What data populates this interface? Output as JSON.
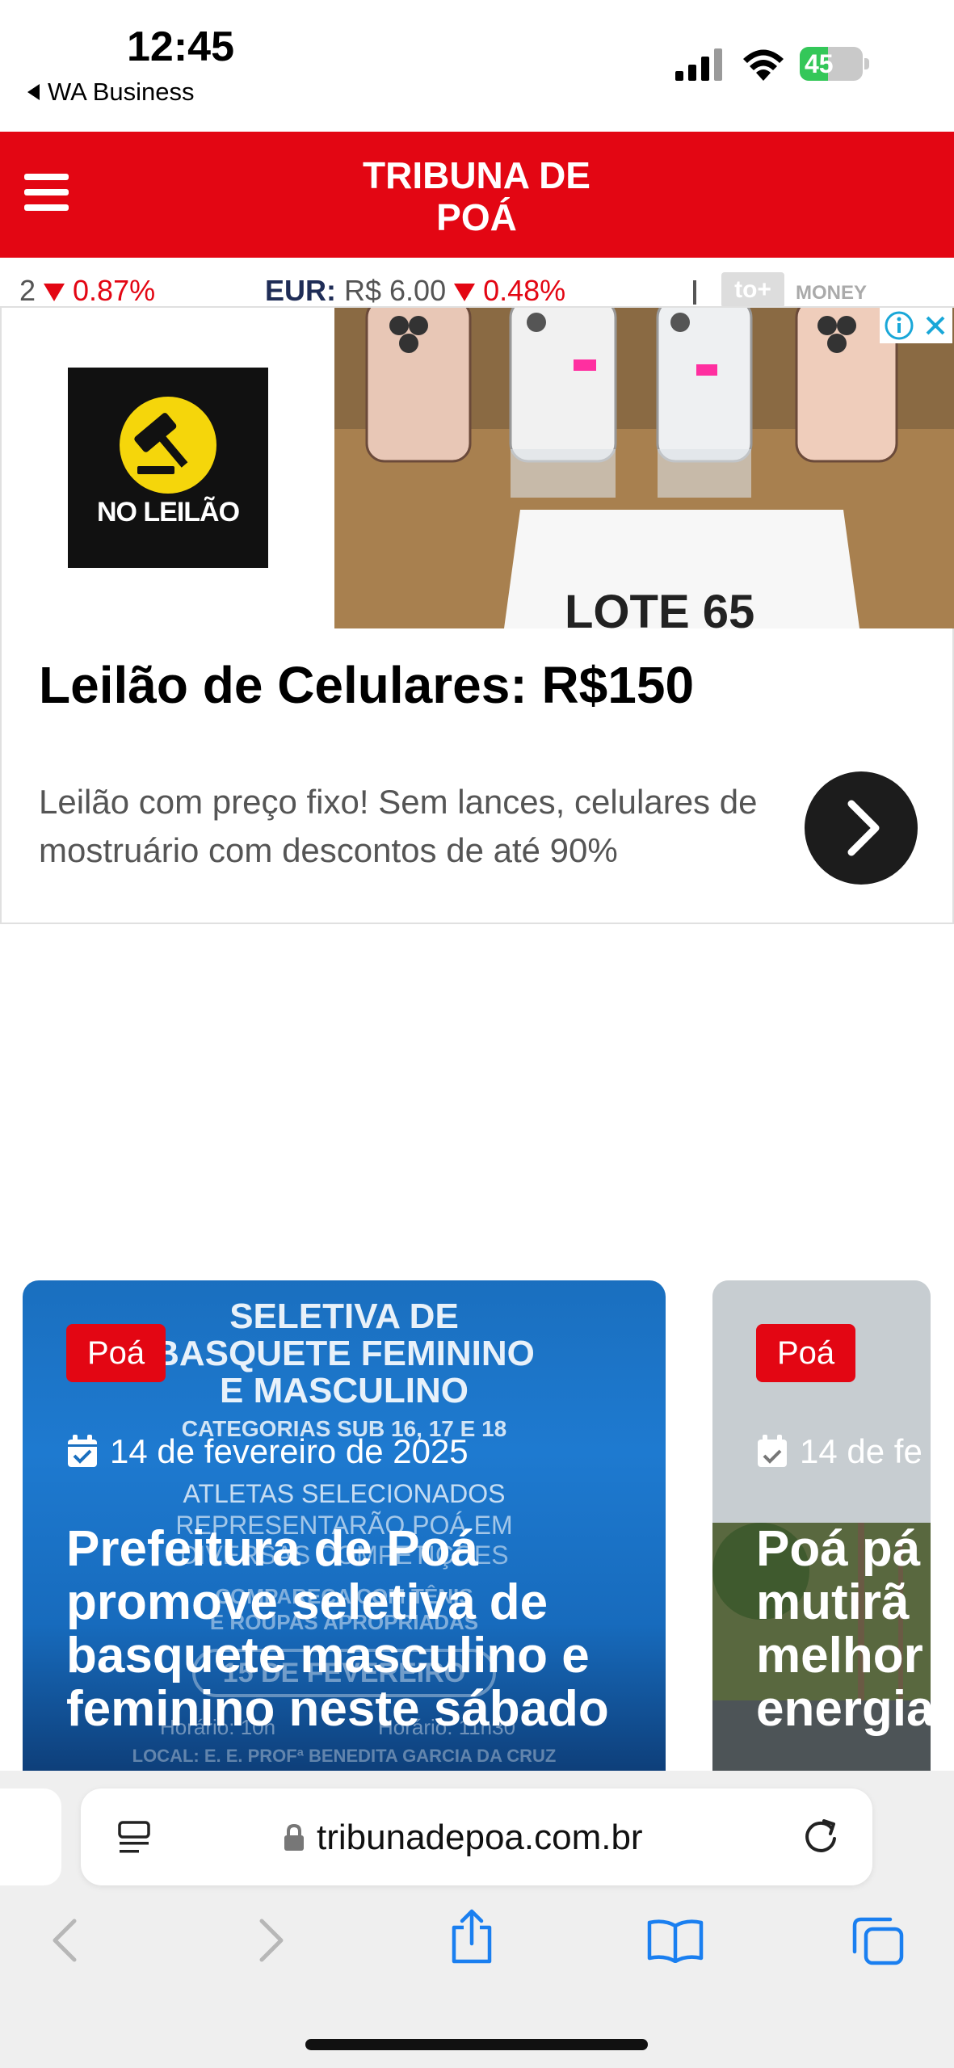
{
  "status_bar": {
    "time": "12:45",
    "back_app": "WA Business",
    "battery": {
      "level_text": "45",
      "level_fraction": 0.45
    }
  },
  "site": {
    "title_line1": "TRIBUNA DE",
    "title_line2": "POÁ"
  },
  "ticker": {
    "item1_value": "2",
    "item1_pct": "0.87%",
    "item2_label": "EUR:",
    "item2_value": "R$ 6.00",
    "item2_pct": "0.48%",
    "badge": "to+",
    "badge_label": "MONEY"
  },
  "ad": {
    "logo_text": "NO LEILÃO",
    "photo_label": "LOTE 65",
    "headline": "Leilão de Celulares: R$150",
    "description": "Leilão com preço fixo! Sem lances, celulares de mostruário com descontos de até 90%"
  },
  "cards": [
    {
      "category": "Poá",
      "date": "14 de fevereiro de 2025",
      "title": "Prefeitura de Poá promove seletiva de basquete masculino e feminino neste sábado",
      "poster": {
        "l1": "SELETIVA DE",
        "l2": "BASQUETE FEMININO",
        "l3": "E MASCULINO",
        "l4": "CATEGORIAS SUB 16, 17 E 18",
        "l5": "ATLETAS SELECIONADOS",
        "l6": "REPRESENTARÃO POÁ EM",
        "l7": "DIVERSAS COMPETIÇÕES",
        "l8": "COMPAREÇA COM TÊNIS",
        "l9": "E ROUPAS APROPRIADAS",
        "l10": "15 DE FEVEREIRO",
        "l11": "Horário: 10h",
        "l12": "Horário: 11h30",
        "l13": "LOCAL: E. E. PROFª BENEDITA GARCIA DA CRUZ"
      }
    },
    {
      "category": "Poá",
      "date": "14 de fe",
      "title": "Poá pá mutirã melhor energia"
    }
  ],
  "browser": {
    "url": "tribunadepoa.com.br"
  },
  "colors": {
    "brand_red": "#e30613",
    "ios_green": "#34c759",
    "ios_blue": "#1a7ff0"
  }
}
